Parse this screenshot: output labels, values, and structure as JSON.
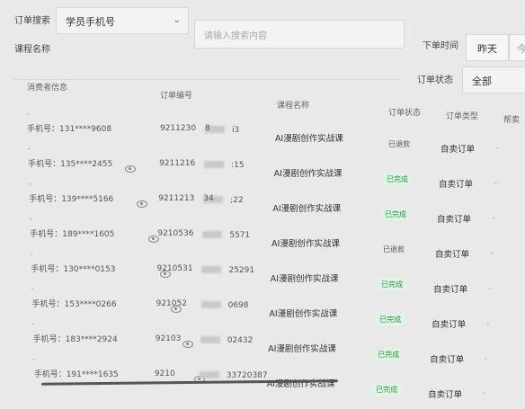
{
  "filters": {
    "order_search_label": "订单搜索",
    "search_type": "学员手机号",
    "search_placeholder": "请输入搜索内容",
    "order_time_label": "下单时间",
    "date_btn": "昨天",
    "date_btn_partial": "今",
    "course_name_label": "课程名称",
    "order_status_label": "订单状态",
    "order_status_value": "全部"
  },
  "table": {
    "headers": {
      "consumer": "消费者信息",
      "order_no": "订单编号",
      "course": "课程名称",
      "status": "订单状态",
      "type": "订单类型",
      "helper": "帮卖"
    },
    "rows": [
      {
        "phone": "手机号：131****9608",
        "order_a": "9211230",
        "order_b": "8",
        "order_c": "i3",
        "course": "AI漫剧创作实战课",
        "status": "已退款",
        "type": "自卖订单"
      },
      {
        "phone": "手机号：135****2455",
        "order_a": "9211216",
        "order_b": "",
        "order_c": ":15",
        "course": "AI漫剧创作实战课",
        "status": "已完成",
        "type": "自卖订单"
      },
      {
        "phone": "手机号：139****5166",
        "order_a": "9211213",
        "order_b": "34",
        "order_c": ";22",
        "course": "AI漫剧创作实战课",
        "status": "已完成",
        "type": "自卖订单"
      },
      {
        "phone": "手机号：189****1605",
        "order_a": "9210536",
        "order_b": "",
        "order_c": "5571",
        "course": "AI漫剧创作实战课",
        "status": "已退款",
        "type": "自卖订单"
      },
      {
        "phone": "手机号：130****0153",
        "order_a": "9210531",
        "order_b": "",
        "order_c": "25291",
        "course": "AI漫剧创作实战课",
        "status": "已完成",
        "type": "自卖订单"
      },
      {
        "phone": "手机号：153****0266",
        "order_a": "921052",
        "order_b": "",
        "order_c": "0698",
        "course": "AI漫剧创作实战课",
        "status": "已完成",
        "type": "自卖订单"
      },
      {
        "phone": "手机号：183****2924",
        "order_a": "92103",
        "order_b": "",
        "order_c": "02432",
        "course": "AI漫剧创作实战课",
        "status": "已完成",
        "type": "自卖订单"
      },
      {
        "phone": "手机号：191****1635",
        "order_a": "9210",
        "order_b": "",
        "order_c": "33720387",
        "course": "AI漫剧创作实战课",
        "status": "已完成",
        "type": "自卖订单"
      }
    ]
  },
  "icons": {
    "eye": "eye-icon",
    "dropdown": "chevron-down-icon"
  },
  "colors": {
    "done_badge_bg": "#dff4e4",
    "done_badge_fg": "#2e9a4b"
  }
}
